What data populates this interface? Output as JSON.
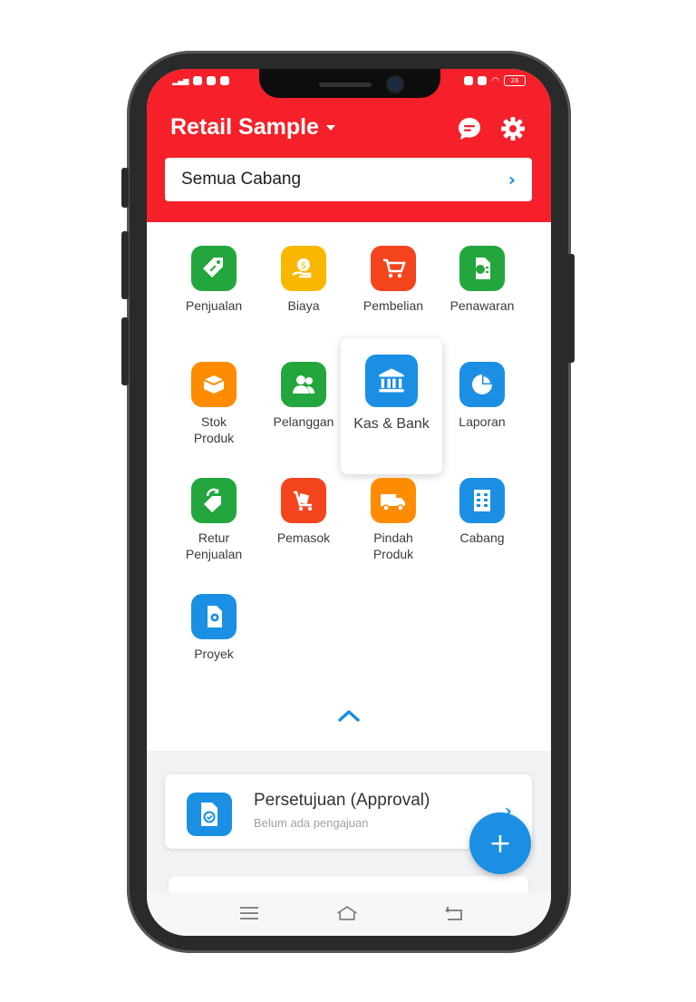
{
  "header": {
    "title": "Retail Sample",
    "branch_selector": "Semua Cabang",
    "accent_color": "#f5202a"
  },
  "status_bar": {
    "battery": "26"
  },
  "menu": {
    "items": [
      {
        "label": "Penjualan",
        "icon": "price-tag-icon",
        "color": "#22a63d"
      },
      {
        "label": "Biaya",
        "icon": "money-hand-icon",
        "color": "#f9b700"
      },
      {
        "label": "Pembelian",
        "icon": "shopping-cart-icon",
        "color": "#f4441e"
      },
      {
        "label": "Penawaran",
        "icon": "quote-document-icon",
        "color": "#22a63d"
      },
      {
        "label": "Stok\nProduk",
        "icon": "product-box-icon",
        "color": "#ff8c00"
      },
      {
        "label": "Pelanggan",
        "icon": "customers-icon",
        "color": "#22a63d"
      },
      {
        "label": "Kas & Bank",
        "icon": "bank-icon",
        "color": "#1a8fe3"
      },
      {
        "label": "Laporan",
        "icon": "pie-chart-icon",
        "color": "#1a8fe3"
      },
      {
        "label": "Retur\nPenjualan",
        "icon": "return-tag-icon",
        "color": "#22a63d"
      },
      {
        "label": "Pemasok",
        "icon": "supplier-cart-icon",
        "color": "#f4441e"
      },
      {
        "label": "Pindah\nProduk",
        "icon": "delivery-truck-icon",
        "color": "#ff8c00"
      },
      {
        "label": "Cabang",
        "icon": "building-icon",
        "color": "#1a8fe3"
      },
      {
        "label": "Proyek",
        "icon": "project-document-icon",
        "color": "#1a8fe3"
      }
    ]
  },
  "approval": {
    "title": "Persetujuan (Approval)",
    "subtitle": "Belum ada pengajuan"
  },
  "fab_label": "+"
}
